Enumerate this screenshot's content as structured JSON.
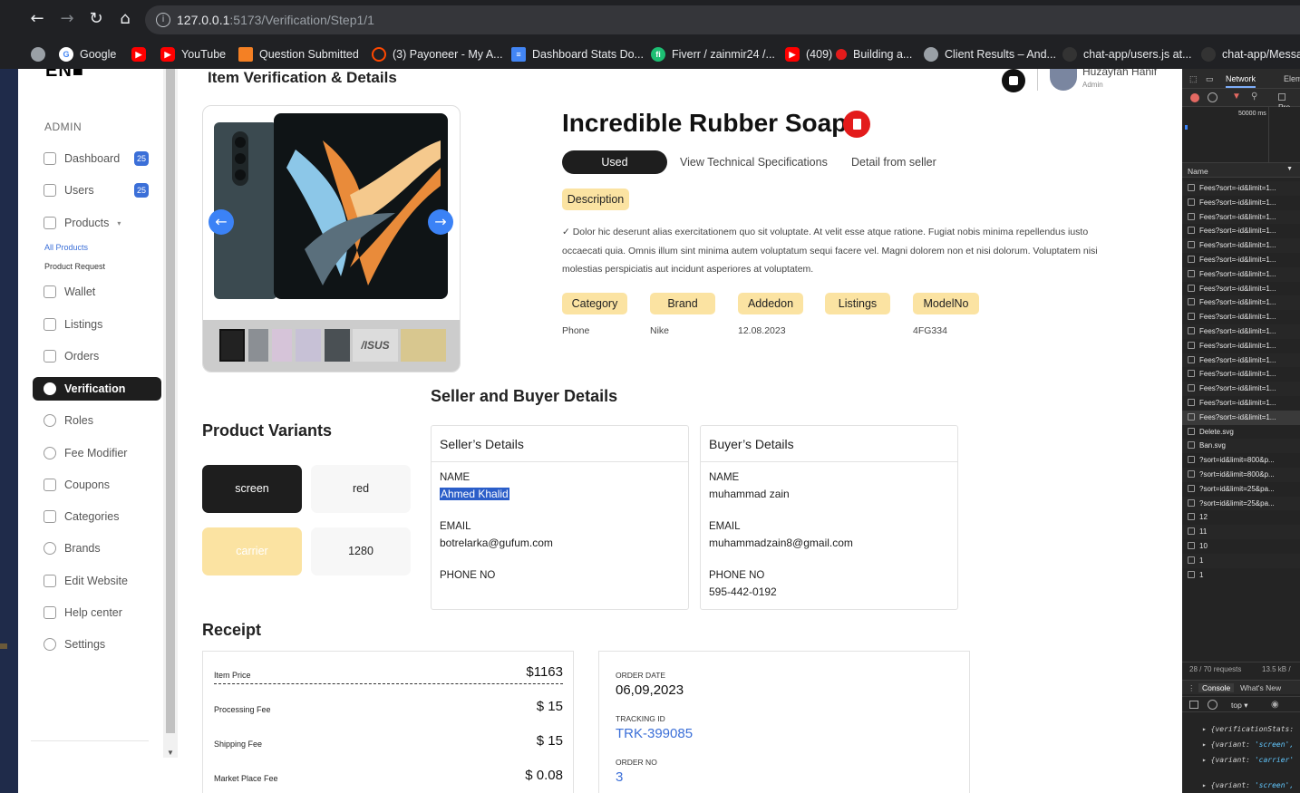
{
  "browser": {
    "url_host": "127.0.0.1",
    "url_rest": ":5173/Verification/Step1/1",
    "bookmarks": [
      {
        "label": "Google",
        "icon": "google-icon",
        "color": "#ffffff"
      },
      {
        "label": "YouTube",
        "icon": "youtube-icon",
        "color": "#ff0000"
      },
      {
        "label": "Question Submitted",
        "icon": "stackoverflow-icon",
        "color": "#f48024"
      },
      {
        "label": "(3) Payoneer - My A...",
        "icon": "payoneer-icon",
        "color": "#ff4800"
      },
      {
        "label": "Dashboard Stats Do...",
        "icon": "docs-icon",
        "color": "#4285f4"
      },
      {
        "label": "Fiverr / zainmir24 /...",
        "icon": "fiverr-icon",
        "color": "#1dbf73"
      },
      {
        "label": "(409)",
        "icon": "youtube-icon",
        "color": "#ff0000"
      },
      {
        "label": "Building a...",
        "icon": "record-icon",
        "color": "#e31b1b"
      },
      {
        "label": "Client Results – And...",
        "icon": "globe-icon",
        "color": "#9aa0a6"
      },
      {
        "label": "chat-app/users.js at...",
        "icon": "github-icon",
        "color": "#333333"
      },
      {
        "label": "chat-app/Messa",
        "icon": "github-icon",
        "color": "#333333"
      }
    ]
  },
  "sidebar": {
    "section_label": "ADMIN",
    "items": [
      {
        "label": "Dashboard",
        "badge": "25"
      },
      {
        "label": "Users",
        "badge": "25"
      },
      {
        "label": "Products"
      },
      {
        "label": "Wallet"
      },
      {
        "label": "Listings"
      },
      {
        "label": "Orders"
      },
      {
        "label": "Verification"
      },
      {
        "label": "Roles"
      },
      {
        "label": "Fee Modifier"
      },
      {
        "label": "Coupons"
      },
      {
        "label": "Categories"
      },
      {
        "label": "Brands"
      },
      {
        "label": "Edit Website"
      },
      {
        "label": "Help center"
      },
      {
        "label": "Settings"
      }
    ],
    "sub_items": [
      "All Products",
      "Product Request"
    ]
  },
  "header": {
    "page_title": "Item Verification & Details",
    "user_name": "Huzayfah Hanif",
    "user_role": "Admin"
  },
  "product": {
    "title": "Incredible Rubber Soap",
    "tabs": [
      "Used",
      "View Technical Specifications",
      "Detail from seller"
    ],
    "description_label": "Description",
    "description": "✓  Dolor hic deserunt alias exercitationem quo sit voluptate. At velit esse atque ratione. Fugiat nobis minima repellendus iusto occaecati quia. Omnis illum sint minima autem voluptatum sequi facere vel. Magni dolorem non et nisi dolorum. Voluptatem nisi molestias perspiciatis aut incidunt asperiores at voluptatem.",
    "attributes": [
      {
        "label": "Category",
        "value": "Phone"
      },
      {
        "label": "Brand",
        "value": "Nike"
      },
      {
        "label": "Addedon",
        "value": "12.08.2023"
      },
      {
        "label": "Listings",
        "value": ""
      },
      {
        "label": "ModelNo",
        "value": "4FG334"
      }
    ]
  },
  "variants": {
    "heading": "Product Variants",
    "items": [
      "screen",
      "red",
      "carrier",
      "1280"
    ]
  },
  "parties": {
    "heading": "Seller and Buyer Details",
    "seller": {
      "title": "Seller’s Details",
      "name_label": "NAME",
      "name": "Ahmed Khalid",
      "email_label": "EMAIL",
      "email": "botrelarka@gufum.com",
      "phone_label": "PHONE NO",
      "phone": ""
    },
    "buyer": {
      "title": "Buyer’s Details",
      "name_label": "NAME",
      "name": "muhammad zain",
      "email_label": "EMAIL",
      "email": "muhammadzain8@gmail.com",
      "phone_label": "PHONE NO",
      "phone": "595-442-0192"
    }
  },
  "receipt": {
    "heading": "Receipt",
    "rows": [
      {
        "label": "Item Price",
        "value": "$1163"
      },
      {
        "label": "Processing Fee",
        "value": "$ 15"
      },
      {
        "label": "Shipping Fee",
        "value": "$ 15"
      },
      {
        "label": "Market Place Fee",
        "value": "$ 0.08"
      }
    ]
  },
  "order": {
    "date_label": "ORDER DATE",
    "date": "06,09,2023",
    "tracking_label": "TRACKING ID",
    "tracking": "TRK-399085",
    "order_no_label": "ORDER NO",
    "order_no": "3"
  },
  "devtools": {
    "tabs": [
      "Network",
      "Elem"
    ],
    "preserve": "Pre",
    "timeline_label": "50000 ms",
    "name_header": "Name",
    "requests": [
      "Fees?sort=-id&limit=1...",
      "Fees?sort=-id&limit=1...",
      "Fees?sort=-id&limit=1...",
      "Fees?sort=-id&limit=1...",
      "Fees?sort=-id&limit=1...",
      "Fees?sort=-id&limit=1...",
      "Fees?sort=-id&limit=1...",
      "Fees?sort=-id&limit=1...",
      "Fees?sort=-id&limit=1...",
      "Fees?sort=-id&limit=1...",
      "Fees?sort=-id&limit=1...",
      "Fees?sort=-id&limit=1...",
      "Fees?sort=-id&limit=1...",
      "Fees?sort=-id&limit=1...",
      "Fees?sort=-id&limit=1...",
      "Fees?sort=-id&limit=1...",
      "Fees?sort=-id&limit=1...",
      "Delete.svg",
      "Ban.svg",
      "?sort=id&limit=800&p...",
      "?sort=id&limit=800&p...",
      "?sort=id&limit=25&pa...",
      "?sort=id&limit=25&pa...",
      "12",
      "11",
      "10",
      "1",
      "1"
    ],
    "status_requests": "28 / 70 requests",
    "status_size": "13.5 kB /",
    "console_tabs": [
      "Console",
      "What's New"
    ],
    "console_context": "top",
    "console_lines": [
      {
        "key": "verificationStats",
        "val": ""
      },
      {
        "key": "variant",
        "val": "'screen',"
      },
      {
        "key": "variant",
        "val": "'carrier'"
      },
      {
        "key": "variant",
        "val": "'screen',"
      }
    ]
  }
}
